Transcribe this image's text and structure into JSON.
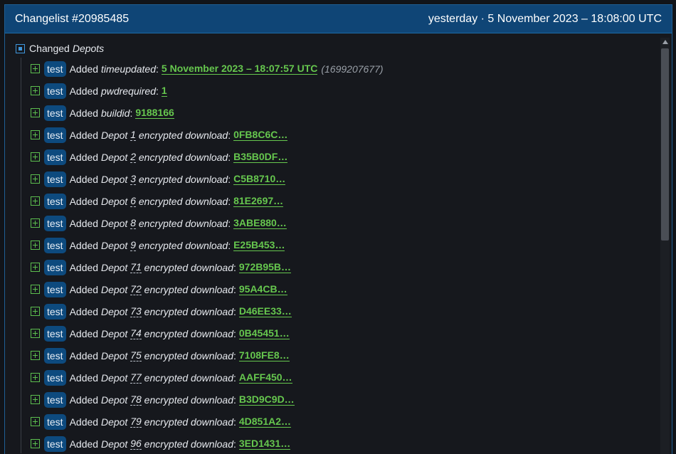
{
  "header": {
    "title": "Changelist #20985485",
    "date": "yesterday · 5 November 2023 – 18:08:00 UTC"
  },
  "root": {
    "label": "Changed",
    "label_italic": "Depots"
  },
  "rows": [
    {
      "badge": "test",
      "prefix": "Added",
      "key": "timeupdated",
      "value": "5 November 2023 – 18:07:57 UTC",
      "extra": "(1699207677)"
    },
    {
      "badge": "test",
      "prefix": "Added",
      "key": "pwdrequired",
      "value": "1"
    },
    {
      "badge": "test",
      "prefix": "Added",
      "key": "buildid",
      "value": "9188166"
    },
    {
      "badge": "test",
      "prefix": "Added",
      "depot_word": "Depot",
      "depot": "1",
      "key": "encrypted download",
      "value": "0FB8C6C…"
    },
    {
      "badge": "test",
      "prefix": "Added",
      "depot_word": "Depot",
      "depot": "2",
      "key": "encrypted download",
      "value": "B35B0DF…"
    },
    {
      "badge": "test",
      "prefix": "Added",
      "depot_word": "Depot",
      "depot": "3",
      "key": "encrypted download",
      "value": "C5B8710…"
    },
    {
      "badge": "test",
      "prefix": "Added",
      "depot_word": "Depot",
      "depot": "6",
      "key": "encrypted download",
      "value": "81E2697…"
    },
    {
      "badge": "test",
      "prefix": "Added",
      "depot_word": "Depot",
      "depot": "8",
      "key": "encrypted download",
      "value": "3ABE880…"
    },
    {
      "badge": "test",
      "prefix": "Added",
      "depot_word": "Depot",
      "depot": "9",
      "key": "encrypted download",
      "value": "E25B453…"
    },
    {
      "badge": "test",
      "prefix": "Added",
      "depot_word": "Depot",
      "depot": "71",
      "key": "encrypted download",
      "value": "972B95B…"
    },
    {
      "badge": "test",
      "prefix": "Added",
      "depot_word": "Depot",
      "depot": "72",
      "key": "encrypted download",
      "value": "95A4CB…"
    },
    {
      "badge": "test",
      "prefix": "Added",
      "depot_word": "Depot",
      "depot": "73",
      "key": "encrypted download",
      "value": "D46EE33…"
    },
    {
      "badge": "test",
      "prefix": "Added",
      "depot_word": "Depot",
      "depot": "74",
      "key": "encrypted download",
      "value": "0B45451…"
    },
    {
      "badge": "test",
      "prefix": "Added",
      "depot_word": "Depot",
      "depot": "75",
      "key": "encrypted download",
      "value": "7108FE8…"
    },
    {
      "badge": "test",
      "prefix": "Added",
      "depot_word": "Depot",
      "depot": "77",
      "key": "encrypted download",
      "value": "AAFF450…"
    },
    {
      "badge": "test",
      "prefix": "Added",
      "depot_word": "Depot",
      "depot": "78",
      "key": "encrypted download",
      "value": "B3D9C9D…"
    },
    {
      "badge": "test",
      "prefix": "Added",
      "depot_word": "Depot",
      "depot": "79",
      "key": "encrypted download",
      "value": "4D851A2…"
    },
    {
      "badge": "test",
      "prefix": "Added",
      "depot_word": "Depot",
      "depot": "96",
      "key": "encrypted download",
      "value": "3ED1431…"
    }
  ],
  "colors": {
    "header_bg": "#0f4576",
    "badge_bg": "#0d4a7e",
    "value_green": "#66c74e",
    "panel_bg": "#16181d"
  }
}
